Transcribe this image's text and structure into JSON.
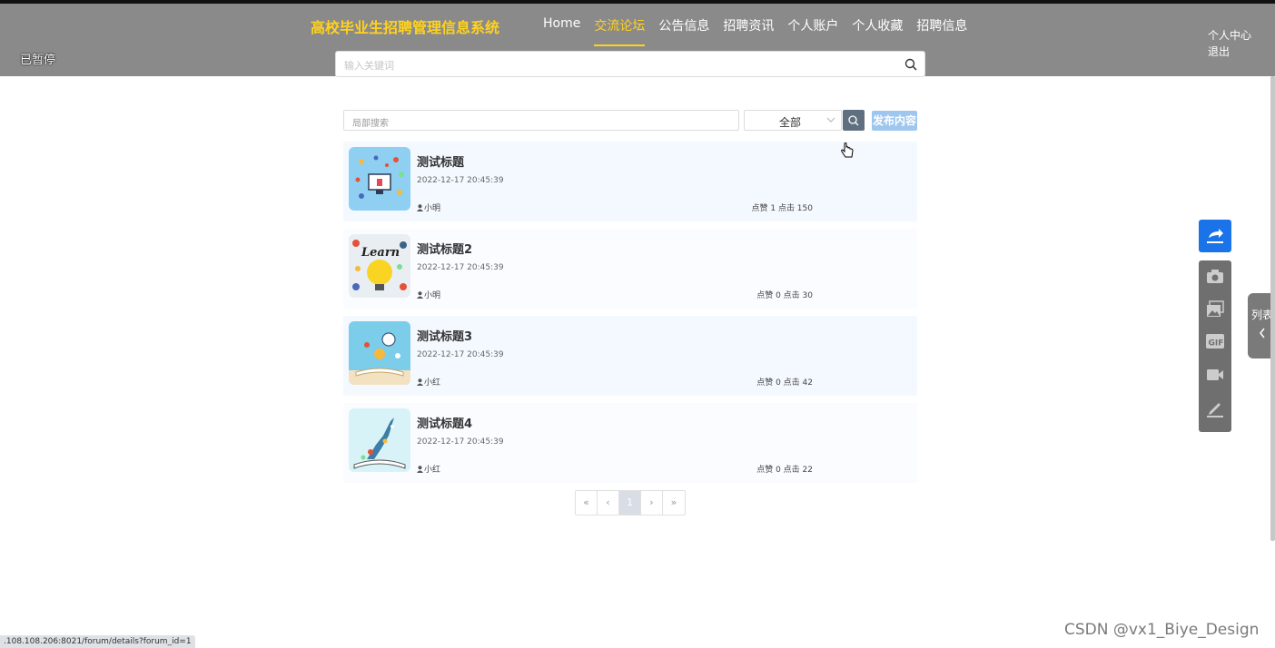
{
  "header": {
    "site_title": "高校毕业生招聘管理信息系统",
    "paused_label": "已暂停",
    "nav": [
      {
        "label": "Home",
        "active": false
      },
      {
        "label": "交流论坛",
        "active": true
      },
      {
        "label": "公告信息",
        "active": false
      },
      {
        "label": "招聘资讯",
        "active": false
      },
      {
        "label": "个人账户",
        "active": false
      },
      {
        "label": "个人收藏",
        "active": false
      },
      {
        "label": "招聘信息",
        "active": false
      }
    ],
    "user_center": "个人中心",
    "logout": "退出",
    "search_placeholder": "输入关键词",
    "accent_color": "#ffd21f"
  },
  "toolbar": {
    "local_search_placeholder": "局部搜索",
    "select_value": "全部",
    "publish_label": "发布内容"
  },
  "posts": [
    {
      "title": "测试标题",
      "time": "2022-12-17 20:45:39",
      "author": "小明",
      "stats": "点赞 1 点击 150"
    },
    {
      "title": "测试标题2",
      "time": "2022-12-17 20:45:39",
      "author": "小明",
      "stats": "点赞 0 点击 30"
    },
    {
      "title": "测试标题3",
      "time": "2022-12-17 20:45:39",
      "author": "小红",
      "stats": "点赞 0 点击 42"
    },
    {
      "title": "测试标题4",
      "time": "2022-12-17 20:45:39",
      "author": "小红",
      "stats": "点赞 0 点击 22"
    }
  ],
  "pagination": {
    "first": "«",
    "prev": "‹",
    "current": "1",
    "next": "›",
    "last": "»"
  },
  "side_panel": {
    "list_tab_label": "列表",
    "tools": [
      "camera-icon",
      "image-icon",
      "gif-icon",
      "video-icon",
      "pen-icon"
    ]
  },
  "status_url": ".108.108.206:8021/forum/details?forum_id=1",
  "watermark": "CSDN @vx1_Biye_Design"
}
